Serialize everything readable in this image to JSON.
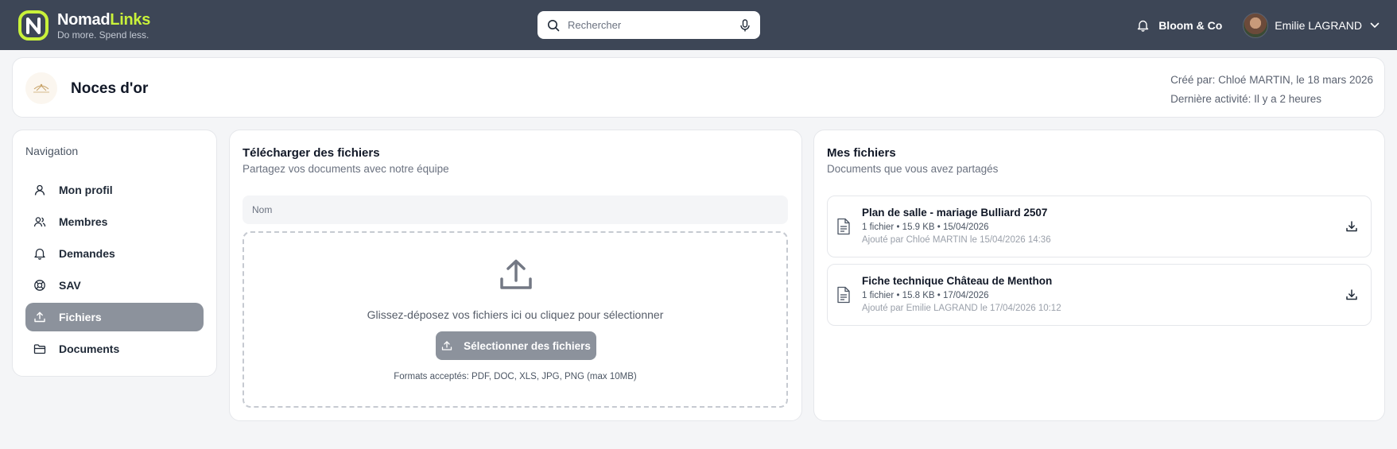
{
  "app": {
    "brand_first": "Nomad",
    "brand_second": "Links",
    "tagline": "Do more. Spend less.",
    "accent_color": "#c9f23a",
    "topbar_color": "#3d4656"
  },
  "search": {
    "placeholder": "Rechercher"
  },
  "header": {
    "organization": "Bloom & Co",
    "user_name": "Emilie LAGRAND"
  },
  "event": {
    "title": "Noces d'or",
    "created_by": "Créé par: Chloé MARTIN, le 18 mars 2026",
    "last_activity": "Dernière activité: Il y a 2 heures"
  },
  "sidebar": {
    "title": "Navigation",
    "items": [
      {
        "label": "Mon profil",
        "icon": "user-icon"
      },
      {
        "label": "Membres",
        "icon": "users-icon"
      },
      {
        "label": "Demandes",
        "icon": "bell-icon"
      },
      {
        "label": "SAV",
        "icon": "lifebuoy-icon"
      },
      {
        "label": "Fichiers",
        "icon": "upload-icon",
        "active": true
      },
      {
        "label": "Documents",
        "icon": "folder-icon"
      }
    ]
  },
  "upload": {
    "title": "Télécharger des fichiers",
    "subtitle": "Partagez vos documents avec notre équipe",
    "name_placeholder": "Nom",
    "drop_text": "Glissez-déposez vos fichiers ici ou cliquez pour sélectionner",
    "button_label": "Sélectionner des fichiers",
    "formats": "Formats acceptés: PDF, DOC, XLS, JPG, PNG (max 10MB)"
  },
  "files": {
    "title": "Mes fichiers",
    "subtitle": "Documents que vous avez partagés",
    "items": [
      {
        "name": "Plan de salle - mariage Bulliard 2507",
        "info": "1 fichier • 15.9 KB • 15/04/2026",
        "added": "Ajouté par Chloé MARTIN le 15/04/2026 14:36"
      },
      {
        "name": "Fiche technique Château de Menthon",
        "info": "1 fichier • 15.8 KB • 17/04/2026",
        "added": "Ajouté par Emilie LAGRAND le 17/04/2026 10:12"
      }
    ]
  }
}
